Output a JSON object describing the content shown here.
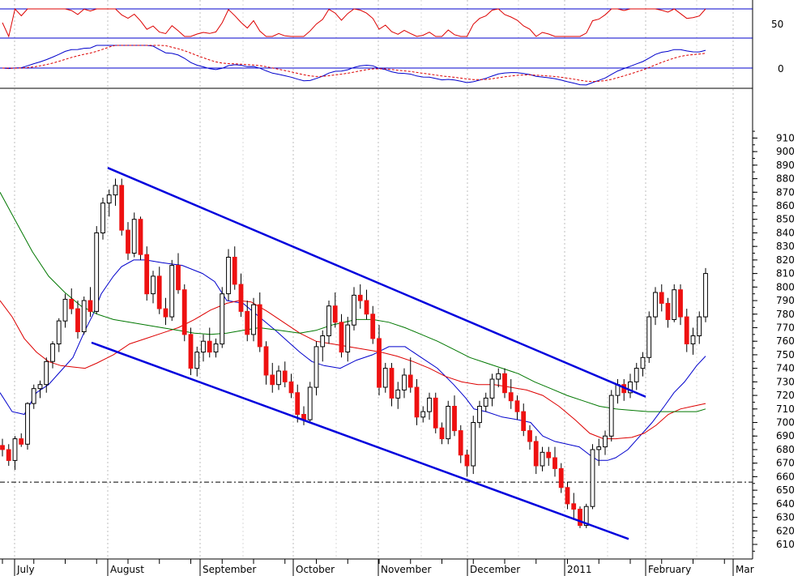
{
  "chart_data": {
    "type": "candlestick",
    "price_axis": {
      "ylim": [
        605,
        915
      ],
      "ticks": [
        610,
        620,
        630,
        640,
        650,
        660,
        670,
        680,
        690,
        700,
        710,
        720,
        730,
        740,
        750,
        760,
        770,
        780,
        790,
        800,
        810,
        820,
        830,
        840,
        850,
        860,
        870,
        880,
        890,
        900,
        910
      ],
      "reference_level": 656
    },
    "rsi_panel": {
      "ticks": [
        50
      ],
      "levels": [
        70,
        30
      ]
    },
    "macd_panel": {
      "ticks": [
        0
      ]
    },
    "months": [
      "July",
      "August",
      "September",
      "October",
      "November",
      "December",
      "2011",
      "February",
      "Mar"
    ],
    "candles": [
      [
        683,
        688,
        675,
        680
      ],
      [
        680,
        684,
        668,
        672
      ],
      [
        672,
        690,
        665,
        688
      ],
      [
        688,
        692,
        682,
        684
      ],
      [
        684,
        715,
        680,
        714
      ],
      [
        714,
        728,
        710,
        725
      ],
      [
        725,
        731,
        718,
        728
      ],
      [
        728,
        748,
        722,
        745
      ],
      [
        745,
        760,
        740,
        758
      ],
      [
        758,
        777,
        752,
        775
      ],
      [
        775,
        795,
        770,
        791
      ],
      [
        791,
        799,
        780,
        784
      ],
      [
        784,
        790,
        762,
        767
      ],
      [
        767,
        793,
        765,
        790
      ],
      [
        790,
        800,
        778,
        782
      ],
      [
        782,
        845,
        780,
        840
      ],
      [
        840,
        866,
        835,
        862
      ],
      [
        862,
        872,
        852,
        868
      ],
      [
        868,
        880,
        860,
        875
      ],
      [
        875,
        880,
        838,
        842
      ],
      [
        842,
        848,
        820,
        825
      ],
      [
        825,
        855,
        822,
        850
      ],
      [
        850,
        852,
        820,
        824
      ],
      [
        824,
        830,
        790,
        795
      ],
      [
        795,
        812,
        788,
        808
      ],
      [
        808,
        815,
        780,
        784
      ],
      [
        784,
        792,
        772,
        778
      ],
      [
        778,
        820,
        775,
        816
      ],
      [
        816,
        825,
        795,
        798
      ],
      [
        798,
        802,
        760,
        765
      ],
      [
        765,
        770,
        735,
        740
      ],
      [
        740,
        756,
        734,
        752
      ],
      [
        752,
        765,
        745,
        760
      ],
      [
        760,
        770,
        748,
        752
      ],
      [
        752,
        762,
        748,
        758
      ],
      [
        758,
        800,
        755,
        795
      ],
      [
        795,
        828,
        790,
        822
      ],
      [
        822,
        830,
        798,
        802
      ],
      [
        802,
        810,
        778,
        782
      ],
      [
        782,
        790,
        760,
        765
      ],
      [
        765,
        792,
        760,
        787
      ],
      [
        787,
        796,
        752,
        756
      ],
      [
        756,
        760,
        728,
        735
      ],
      [
        735,
        744,
        722,
        728
      ],
      [
        728,
        742,
        724,
        738
      ],
      [
        738,
        745,
        726,
        730
      ],
      [
        730,
        736,
        718,
        722
      ],
      [
        722,
        728,
        700,
        706
      ],
      [
        706,
        712,
        698,
        702
      ],
      [
        702,
        730,
        700,
        726
      ],
      [
        726,
        760,
        720,
        756
      ],
      [
        756,
        768,
        745,
        764
      ],
      [
        764,
        790,
        758,
        786
      ],
      [
        786,
        796,
        770,
        774
      ],
      [
        774,
        780,
        748,
        752
      ],
      [
        752,
        778,
        745,
        772
      ],
      [
        772,
        800,
        768,
        794
      ],
      [
        794,
        802,
        784,
        790
      ],
      [
        790,
        798,
        776,
        780
      ],
      [
        780,
        786,
        758,
        762
      ],
      [
        762,
        772,
        720,
        726
      ],
      [
        726,
        744,
        722,
        740
      ],
      [
        740,
        744,
        712,
        718
      ],
      [
        718,
        730,
        710,
        724
      ],
      [
        724,
        740,
        718,
        735
      ],
      [
        735,
        748,
        722,
        726
      ],
      [
        726,
        732,
        698,
        704
      ],
      [
        704,
        712,
        700,
        708
      ],
      [
        708,
        722,
        702,
        718
      ],
      [
        718,
        722,
        692,
        696
      ],
      [
        696,
        700,
        684,
        688
      ],
      [
        688,
        716,
        684,
        712
      ],
      [
        712,
        720,
        690,
        694
      ],
      [
        694,
        698,
        670,
        676
      ],
      [
        676,
        680,
        660,
        668
      ],
      [
        668,
        705,
        662,
        700
      ],
      [
        700,
        716,
        696,
        712
      ],
      [
        712,
        722,
        708,
        718
      ],
      [
        718,
        736,
        712,
        732
      ],
      [
        732,
        740,
        726,
        736
      ],
      [
        736,
        740,
        718,
        722
      ],
      [
        722,
        732,
        710,
        716
      ],
      [
        716,
        720,
        702,
        708
      ],
      [
        708,
        714,
        690,
        694
      ],
      [
        694,
        698,
        680,
        686
      ],
      [
        686,
        690,
        662,
        668
      ],
      [
        668,
        682,
        664,
        678
      ],
      [
        678,
        682,
        668,
        674
      ],
      [
        674,
        682,
        660,
        666
      ],
      [
        666,
        670,
        648,
        652
      ],
      [
        652,
        656,
        636,
        640
      ],
      [
        640,
        648,
        628,
        636
      ],
      [
        636,
        638,
        622,
        624
      ],
      [
        624,
        640,
        622,
        638
      ],
      [
        638,
        684,
        636,
        680
      ],
      [
        680,
        688,
        668,
        682
      ],
      [
        682,
        694,
        676,
        690
      ],
      [
        690,
        724,
        686,
        720
      ],
      [
        720,
        732,
        714,
        728
      ],
      [
        728,
        732,
        716,
        722
      ],
      [
        722,
        736,
        718,
        730
      ],
      [
        730,
        744,
        724,
        740
      ],
      [
        740,
        752,
        734,
        748
      ],
      [
        748,
        782,
        744,
        778
      ],
      [
        778,
        800,
        772,
        796
      ],
      [
        796,
        802,
        782,
        788
      ],
      [
        788,
        792,
        770,
        776
      ],
      [
        776,
        802,
        774,
        798
      ],
      [
        798,
        802,
        772,
        778
      ],
      [
        778,
        784,
        752,
        758
      ],
      [
        758,
        770,
        750,
        764
      ],
      [
        764,
        782,
        758,
        778
      ],
      [
        778,
        814,
        774,
        810
      ]
    ],
    "indicator_lines": [
      {
        "name": "",
        "color": "#0000cc",
        "values": [
          [
            0,
            722
          ],
          [
            15,
            708
          ],
          [
            30,
            706
          ],
          [
            45,
            722
          ],
          [
            60,
            728
          ],
          [
            75,
            738
          ],
          [
            90,
            748
          ],
          [
            105,
            768
          ],
          [
            115,
            780
          ],
          [
            125,
            795
          ],
          [
            140,
            808
          ],
          [
            150,
            815
          ],
          [
            165,
            820
          ],
          [
            180,
            820
          ],
          [
            200,
            818
          ],
          [
            225,
            816
          ],
          [
            250,
            810
          ],
          [
            265,
            804
          ],
          [
            280,
            790
          ],
          [
            300,
            788
          ],
          [
            320,
            778
          ],
          [
            340,
            768
          ],
          [
            355,
            760
          ],
          [
            370,
            752
          ],
          [
            385,
            745
          ],
          [
            400,
            742
          ],
          [
            420,
            740
          ],
          [
            440,
            746
          ],
          [
            460,
            750
          ],
          [
            480,
            756
          ],
          [
            500,
            756
          ],
          [
            520,
            748
          ],
          [
            540,
            740
          ],
          [
            560,
            728
          ],
          [
            575,
            718
          ],
          [
            585,
            710
          ],
          [
            600,
            708
          ],
          [
            620,
            704
          ],
          [
            640,
            702
          ],
          [
            655,
            700
          ],
          [
            670,
            690
          ],
          [
            685,
            686
          ],
          [
            700,
            684
          ],
          [
            715,
            682
          ],
          [
            728,
            676
          ],
          [
            738,
            672
          ],
          [
            750,
            672
          ],
          [
            760,
            674
          ],
          [
            775,
            680
          ],
          [
            790,
            690
          ],
          [
            805,
            700
          ],
          [
            820,
            712
          ],
          [
            832,
            722
          ],
          [
            845,
            730
          ],
          [
            860,
            742
          ],
          [
            871,
            749
          ]
        ]
      },
      {
        "name": "",
        "color": "#dd0000",
        "values": [
          [
            0,
            790
          ],
          [
            15,
            778
          ],
          [
            30,
            762
          ],
          [
            45,
            752
          ],
          [
            60,
            745
          ],
          [
            75,
            742
          ],
          [
            90,
            741
          ],
          [
            105,
            740
          ],
          [
            120,
            744
          ],
          [
            140,
            750
          ],
          [
            160,
            758
          ],
          [
            180,
            762
          ],
          [
            200,
            766
          ],
          [
            220,
            770
          ],
          [
            240,
            776
          ],
          [
            260,
            783
          ],
          [
            280,
            788
          ],
          [
            295,
            790
          ],
          [
            310,
            789
          ],
          [
            330,
            782
          ],
          [
            350,
            774
          ],
          [
            370,
            766
          ],
          [
            390,
            760
          ],
          [
            410,
            758
          ],
          [
            430,
            756
          ],
          [
            450,
            754
          ],
          [
            470,
            752
          ],
          [
            490,
            749
          ],
          [
            510,
            745
          ],
          [
            530,
            740
          ],
          [
            550,
            734
          ],
          [
            570,
            730
          ],
          [
            590,
            728
          ],
          [
            610,
            728
          ],
          [
            630,
            726
          ],
          [
            650,
            724
          ],
          [
            670,
            720
          ],
          [
            690,
            712
          ],
          [
            710,
            702
          ],
          [
            728,
            692
          ],
          [
            745,
            688
          ],
          [
            760,
            688
          ],
          [
            780,
            689
          ],
          [
            795,
            692
          ],
          [
            810,
            698
          ],
          [
            825,
            706
          ],
          [
            840,
            710
          ],
          [
            855,
            712
          ],
          [
            871,
            714
          ]
        ]
      },
      {
        "name": "",
        "color": "#007700",
        "values": [
          [
            0,
            870
          ],
          [
            20,
            848
          ],
          [
            40,
            826
          ],
          [
            60,
            808
          ],
          [
            80,
            796
          ],
          [
            100,
            786
          ],
          [
            120,
            780
          ],
          [
            140,
            776
          ],
          [
            160,
            774
          ],
          [
            180,
            772
          ],
          [
            200,
            770
          ],
          [
            220,
            768
          ],
          [
            240,
            766
          ],
          [
            260,
            765
          ],
          [
            280,
            766
          ],
          [
            300,
            768
          ],
          [
            320,
            770
          ],
          [
            345,
            768
          ],
          [
            370,
            766
          ],
          [
            390,
            768
          ],
          [
            410,
            772
          ],
          [
            440,
            776
          ],
          [
            460,
            776
          ],
          [
            480,
            774
          ],
          [
            500,
            770
          ],
          [
            520,
            765
          ],
          [
            540,
            760
          ],
          [
            560,
            754
          ],
          [
            580,
            748
          ],
          [
            600,
            744
          ],
          [
            620,
            740
          ],
          [
            640,
            736
          ],
          [
            660,
            730
          ],
          [
            680,
            725
          ],
          [
            700,
            720
          ],
          [
            720,
            716
          ],
          [
            740,
            712
          ],
          [
            760,
            710
          ],
          [
            780,
            709
          ],
          [
            800,
            708
          ],
          [
            820,
            708
          ],
          [
            840,
            708
          ],
          [
            860,
            708
          ],
          [
            871,
            710
          ]
        ]
      }
    ],
    "trendlines": [
      {
        "x1": 133,
        "y1": 888,
        "x2": 797,
        "y2": 719
      },
      {
        "x1": 113,
        "y1": 759,
        "x2": 776,
        "y2": 614
      }
    ]
  }
}
